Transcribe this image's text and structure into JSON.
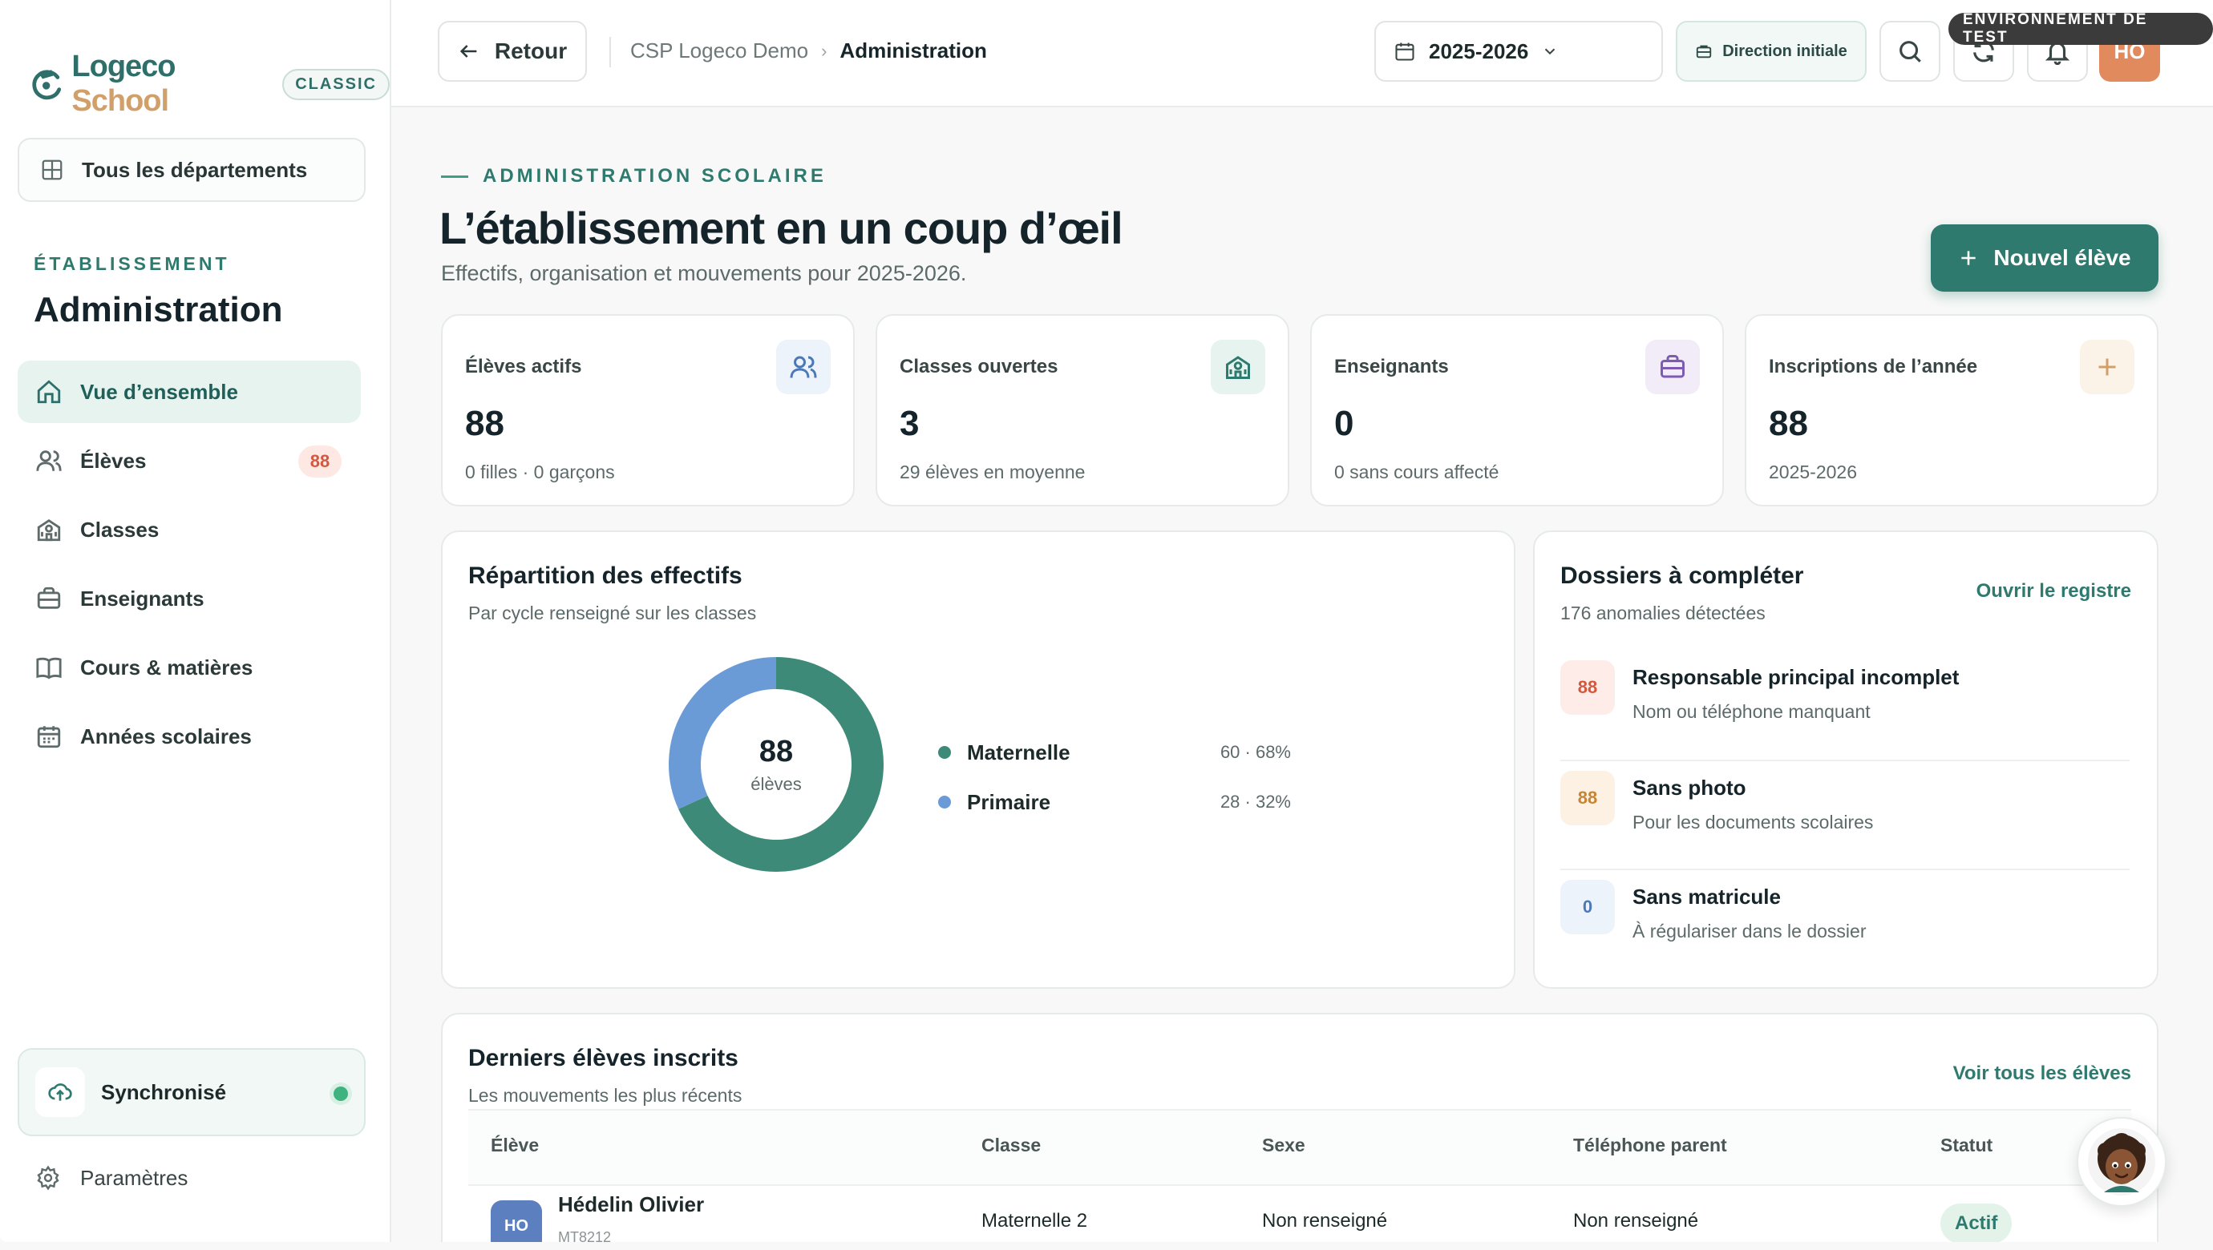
{
  "brand": {
    "name_part1": "Logeco",
    "name_part2": "School",
    "badge": "CLASSIC",
    "primary_color": "#2f7a6e",
    "accent_color": "#d1a06a"
  },
  "sidebar": {
    "department_button": "Tous les départements",
    "section_label": "ÉTABLISSEMENT",
    "section_title": "Administration",
    "items": [
      {
        "label": "Vue d’ensemble",
        "icon": "home-icon",
        "active": true
      },
      {
        "label": "Élèves",
        "icon": "users-icon",
        "badge": "88"
      },
      {
        "label": "Classes",
        "icon": "school-icon"
      },
      {
        "label": "Enseignants",
        "icon": "briefcase-icon"
      },
      {
        "label": "Cours & matières",
        "icon": "book-icon"
      },
      {
        "label": "Années scolaires",
        "icon": "calendar-icon"
      }
    ],
    "sync_label": "Synchronisé",
    "settings_label": "Paramètres"
  },
  "topbar": {
    "back_label": "Retour",
    "breadcrumb": [
      "CSP Logeco Demo",
      "Administration"
    ],
    "year": "2025-2026",
    "direction_label": "Direction initiale",
    "user_initials": "HO",
    "env_badge": "ENVIRONNEMENT DE TEST"
  },
  "header": {
    "kicker": "ADMINISTRATION SCOLAIRE",
    "title": "L’établissement en un coup d’œil",
    "subtitle": "Effectifs, organisation et mouvements pour 2025-2026.",
    "new_button": "Nouvel élève"
  },
  "kpis": [
    {
      "label": "Élèves actifs",
      "value": "88",
      "sub": "0 filles · 0 garçons",
      "icon": "users-icon",
      "color": "#4d78b8",
      "bg": "#edf3fb"
    },
    {
      "label": "Classes ouvertes",
      "value": "3",
      "sub": "29 élèves en moyenne",
      "icon": "school-icon",
      "color": "#2f7a6e",
      "bg": "#e6f3ef"
    },
    {
      "label": "Enseignants",
      "value": "0",
      "sub": "0 sans cours affecté",
      "icon": "briefcase-icon",
      "color": "#7e5bb3",
      "bg": "#f1ecf8"
    },
    {
      "label": "Inscriptions de l’année",
      "value": "88",
      "sub": "2025-2026",
      "icon": "plus-icon",
      "color": "#d1a06a",
      "bg": "#fcf3e8"
    }
  ],
  "repartition": {
    "title": "Répartition des effectifs",
    "subtitle": "Par cycle renseigné sur les classes",
    "total": "88",
    "total_label": "élèves"
  },
  "chart_data": {
    "type": "pie",
    "categories": [
      "Maternelle",
      "Primaire"
    ],
    "values": [
      60,
      28
    ],
    "percentages": [
      68,
      32
    ],
    "value_labels": [
      "60 · 68%",
      "28 · 32%"
    ],
    "colors": [
      "#3d8a78",
      "#6b9bd6"
    ],
    "legend": "right"
  },
  "dossiers": {
    "title": "Dossiers à compléter",
    "subtitle": "176 anomalies détectées",
    "link": "Ouvrir le registre",
    "items": [
      {
        "count": "88",
        "title": "Responsable principal incomplet",
        "sub": "Nom ou téléphone manquant",
        "color": "#d4573e",
        "bg": "#fdece7"
      },
      {
        "count": "88",
        "title": "Sans photo",
        "sub": "Pour les documents scolaires",
        "color": "#c78432",
        "bg": "#fcf1e2"
      },
      {
        "count": "0",
        "title": "Sans matricule",
        "sub": "À régulariser dans le dossier",
        "color": "#4d78b8",
        "bg": "#edf3fb"
      }
    ]
  },
  "recent": {
    "title": "Derniers élèves inscrits",
    "subtitle": "Les mouvements les plus récents",
    "link": "Voir tous les élèves",
    "columns": [
      "Élève",
      "Classe",
      "Sexe",
      "Téléphone parent",
      "Statut"
    ],
    "rows": [
      {
        "initials": "HO",
        "name": "Hédelin Olivier",
        "matricule": "MT8212",
        "classe": "Maternelle 2",
        "sexe": "Non renseigné",
        "telephone": "Non renseigné",
        "statut": "Actif"
      }
    ]
  }
}
